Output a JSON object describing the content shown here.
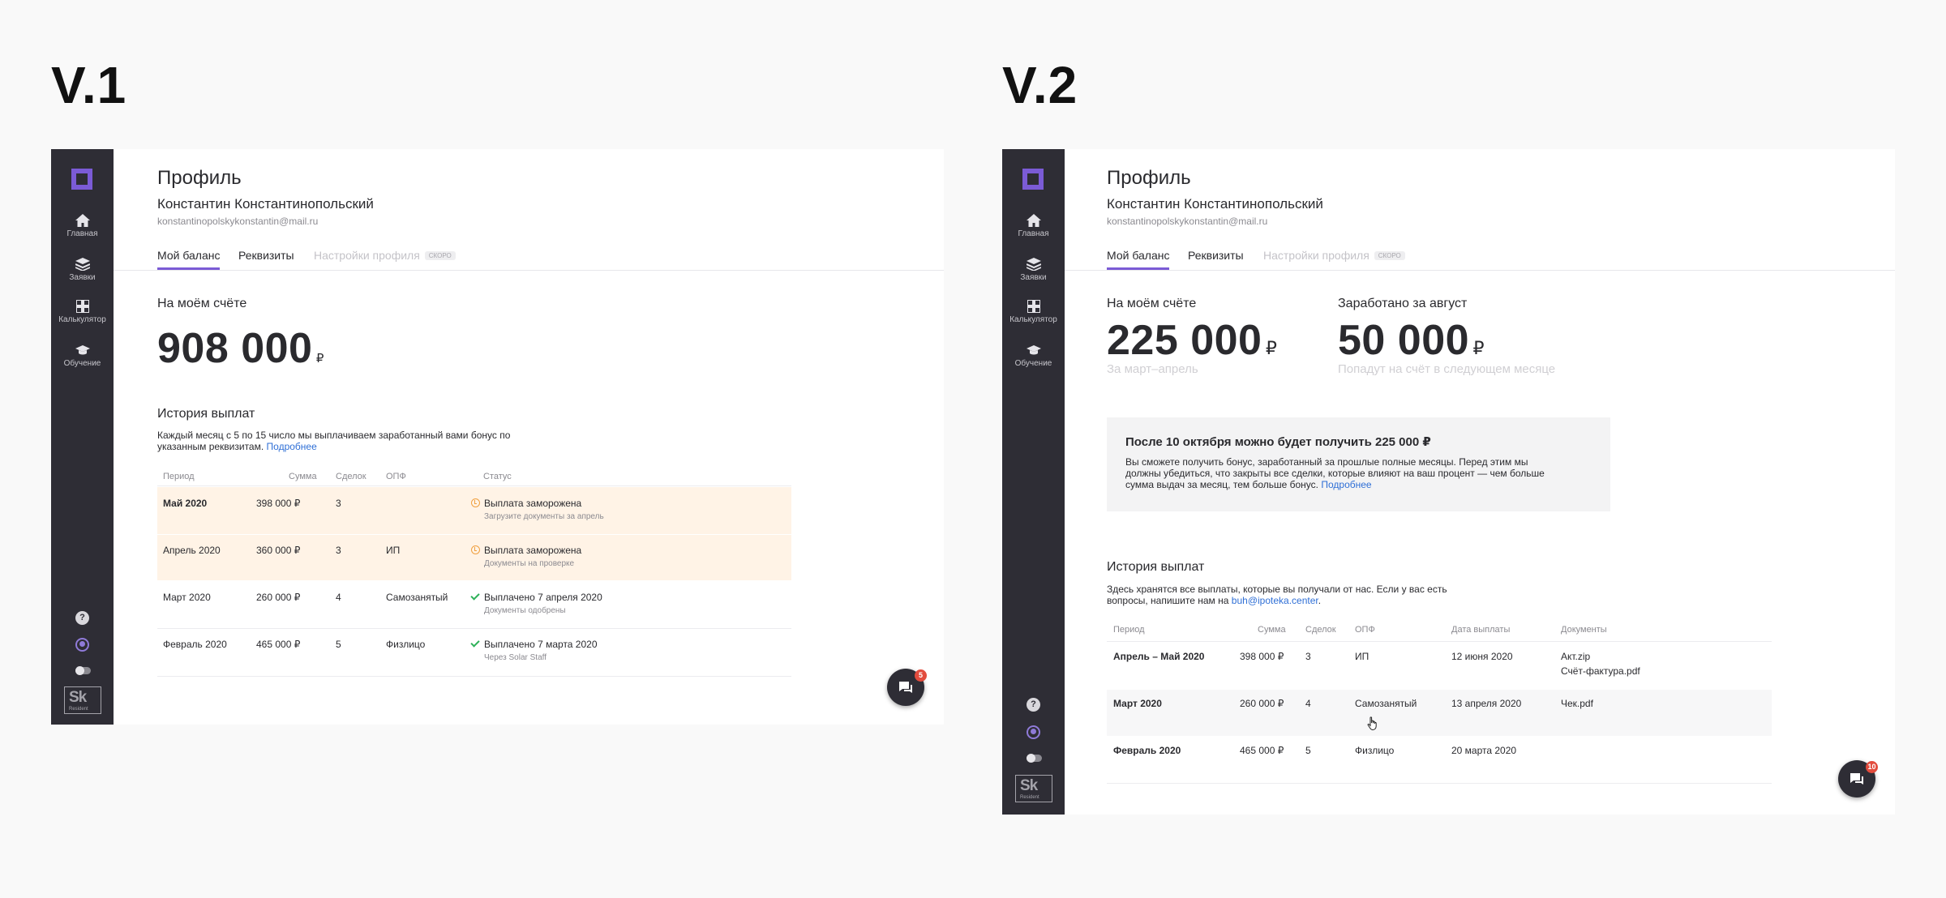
{
  "versions": {
    "v1": "V.1",
    "v2": "V.2"
  },
  "nav": {
    "home": "Главная",
    "requests": "Заявки",
    "calculator": "Калькулятор",
    "learning": "Обучение",
    "help": "?",
    "brand_logo": "Sk",
    "brand_sub": "Resident"
  },
  "profile": {
    "title": "Профиль",
    "name": "Константин Константинопольский",
    "email": "konstantinopolskykonstantin@mail.ru"
  },
  "tabs": {
    "balance": "Мой баланс",
    "requisites": "Реквизиты",
    "settings": "Настройки профиля",
    "soon": "СКОРО"
  },
  "currency": "₽",
  "v1": {
    "account_title": "На моём счёте",
    "account_amount": "908 000",
    "history_title": "История выплат",
    "history_desc": "Каждый месяц с 5 по 15 число мы выплачиваем заработанный вами бонус по указанным реквизитам.",
    "history_link": "Подробнее",
    "columns": {
      "period": "Период",
      "sum": "Сумма",
      "deals": "Сделок",
      "opf": "ОПФ",
      "status": "Статус"
    },
    "rows": [
      {
        "period": "Май 2020",
        "sum": "398 000 ₽",
        "deals": "3",
        "opf": "",
        "status": "Выплата заморожена",
        "sub": "Загрузите документы за апрель"
      },
      {
        "period": "Апрель 2020",
        "sum": "360 000 ₽",
        "deals": "3",
        "opf": "ИП",
        "status": "Выплата заморожена",
        "sub": "Документы на проверке"
      },
      {
        "period": "Март 2020",
        "sum": "260 000 ₽",
        "deals": "4",
        "opf": "Самозанятый",
        "status": "Выплачено 7 апреля 2020",
        "sub": "Документы одобрены"
      },
      {
        "period": "Февраль 2020",
        "sum": "465 000 ₽",
        "deals": "5",
        "opf": "Физлицо",
        "status": "Выплачено 7 марта 2020",
        "sub": "Через Solar Staff"
      }
    ],
    "chat_badge": "5"
  },
  "v2": {
    "account_title": "На моём счёте",
    "account_amount": "225 000",
    "account_hint": "За март–апрель",
    "earned_title": "Заработано за август",
    "earned_amount": "50 000",
    "earned_hint": "Попадут на счёт в следующем месяце",
    "notice_title": "После 10 октября можно будет получить 225 000 ₽",
    "notice_text": "Вы сможете получить бонус, заработанный за прошлые полные месяцы. Перед этим мы должны убедиться, что закрыты все сделки, которые влияют на ваш процент — чем больше сумма выдач за месяц, тем больше бонус.",
    "notice_link": "Подробнее",
    "history_title": "История выплат",
    "history_desc": "Здесь хранятся все выплаты, которые вы получали от нас. Если у вас есть вопросы, напишите нам на",
    "history_email": "buh@ipoteka.center",
    "columns": {
      "period": "Период",
      "sum": "Сумма",
      "deals": "Сделок",
      "opf": "ОПФ",
      "date": "Дата выплаты",
      "docs": "Документы"
    },
    "rows": [
      {
        "period": "Апрель – Май 2020",
        "sum": "398 000 ₽",
        "deals": "3",
        "opf": "ИП",
        "date": "12 июня 2020",
        "doc1": "Акт.zip",
        "doc2": "Счёт-фактура.pdf"
      },
      {
        "period": "Март 2020",
        "sum": "260 000 ₽",
        "deals": "4",
        "opf": "Самозанятый",
        "date": "13 апреля 2020",
        "doc1": "Чек.pdf",
        "doc2": ""
      },
      {
        "period": "Февраль 2020",
        "sum": "465 000 ₽",
        "deals": "5",
        "opf": "Физлицо",
        "date": "20 марта 2020",
        "doc1": "",
        "doc2": ""
      }
    ],
    "chat_badge": "10"
  },
  "colors": {
    "accent": "#7b5bd6",
    "sidebar": "#2e2d35",
    "link": "#2f6fd6",
    "frozen_row": "#fff3e6",
    "success": "#2eb159",
    "warning": "#f0a040"
  }
}
